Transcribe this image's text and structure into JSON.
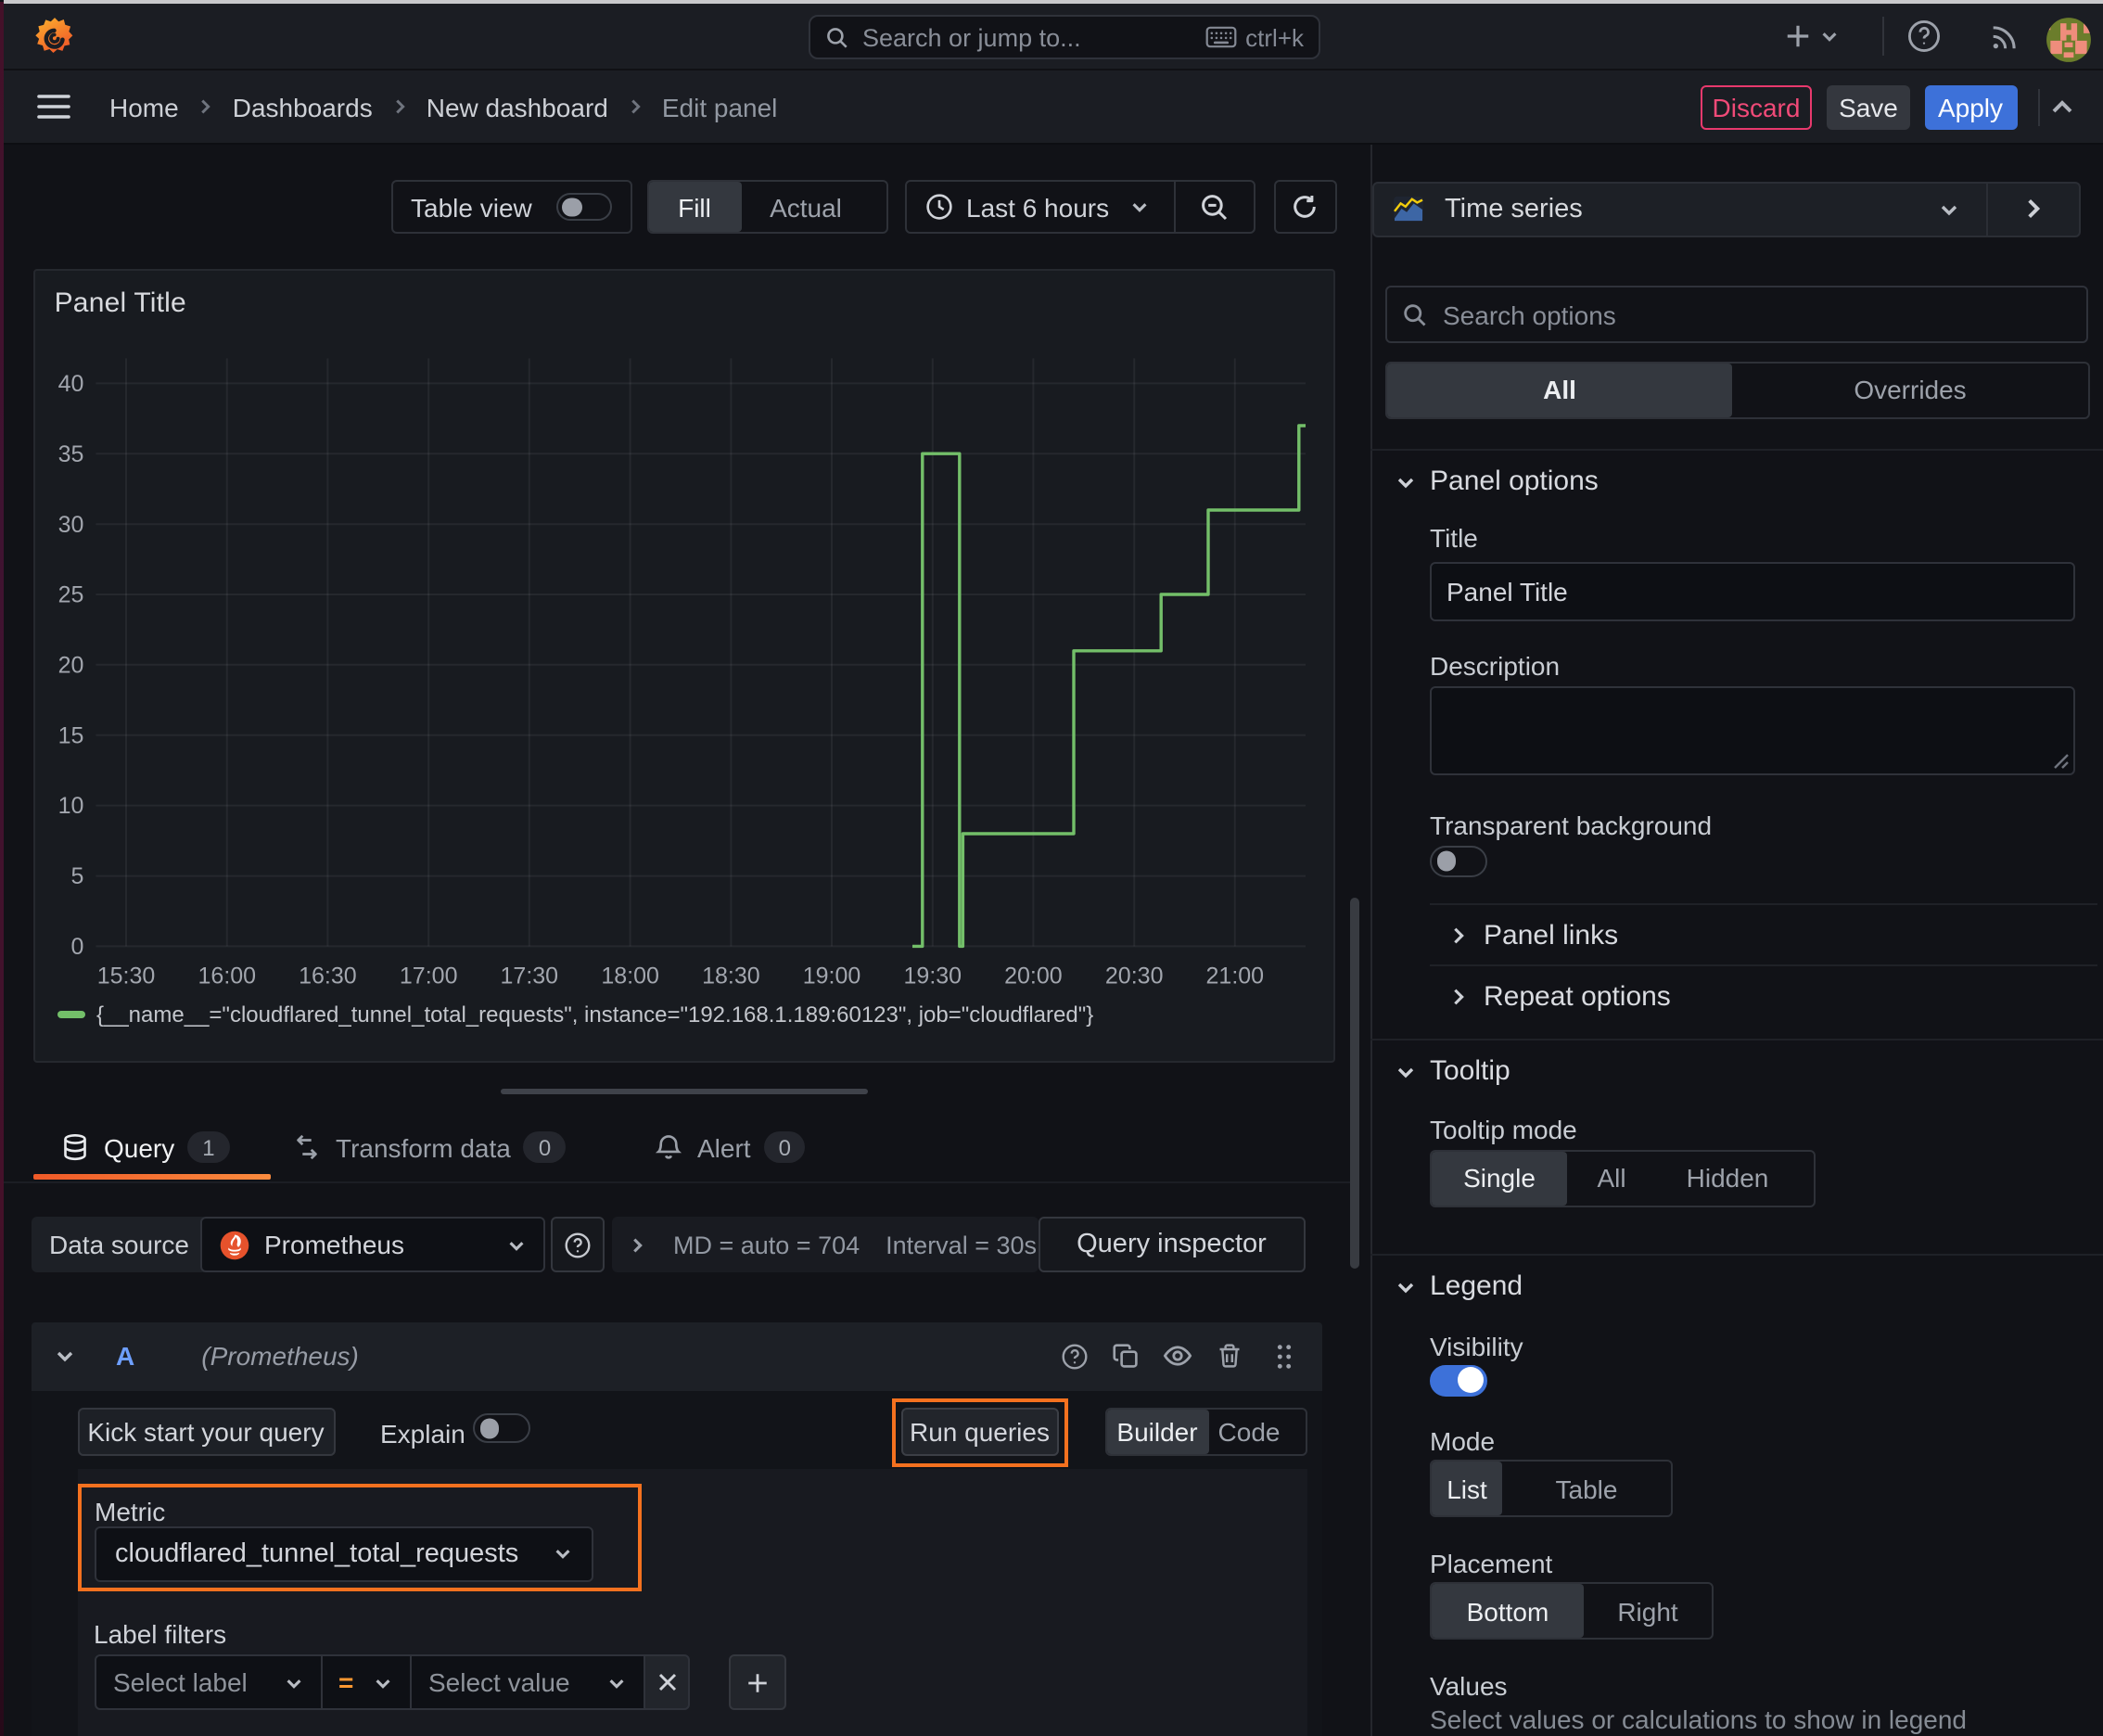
{
  "colors": {
    "accent_orange": "#f4711f",
    "tab_orange": "#f05a28",
    "series_green": "#73bf69",
    "primary_blue": "#3d71d9",
    "discard_pink": "#f14a78"
  },
  "icons": {
    "grafana-logo": "orange spiral flame logo",
    "search-icon": "magnifier",
    "keyboard-icon": "keyboard",
    "plus-icon": "+",
    "chevron-down-icon": "v",
    "chevron-right-icon": ">",
    "chevron-up-icon": "^",
    "help-icon": "? in circle",
    "rss-icon": "rss arcs",
    "avatar": "pixel-art avatar",
    "hamburger-icon": "three bars",
    "clock-icon": "clock",
    "zoom-out-icon": "magnifier with minus",
    "refresh-icon": "circular arrow",
    "timeseries-icon": "mini area chart",
    "database-icon": "db cylinder",
    "transform-icon": "cycle arrows",
    "bell-icon": "bell",
    "copy-icon": "two squares",
    "eye-icon": "eye",
    "trash-icon": "trash can",
    "grip-icon": "six dots",
    "close-icon": "x",
    "prometheus-icon": "orange flame circle",
    "resize-corner-icon": "diagonal grips"
  },
  "topbar": {
    "search_placeholder": "Search or jump to...",
    "search_shortcut": "ctrl+k"
  },
  "breadcrumb": {
    "items": [
      {
        "label": "Home"
      },
      {
        "label": "Dashboards"
      },
      {
        "label": "New dashboard"
      },
      {
        "label": "Edit panel"
      }
    ]
  },
  "actions": {
    "discard": "Discard",
    "save": "Save",
    "apply": "Apply"
  },
  "toolbar": {
    "table_view_label": "Table view",
    "table_view_on": false,
    "fill_actual": {
      "options": [
        "Fill",
        "Actual"
      ],
      "selected": "Fill"
    },
    "time_range": "Last 6 hours"
  },
  "visualization_picker": {
    "label": "Time series"
  },
  "panel": {
    "title": "Panel Title",
    "legend": "{__name__=\"cloudflared_tunnel_total_requests\", instance=\"192.168.1.189:60123\", job=\"cloudflared\"}"
  },
  "chart_data": {
    "type": "line",
    "line_style": "step-after",
    "series": [
      {
        "name": "{__name__=\"cloudflared_tunnel_total_requests\", instance=\"192.168.1.189:60123\", job=\"cloudflared\"}",
        "color": "#73bf69",
        "points": [
          [
            "19:24",
            0
          ],
          [
            "19:27",
            35
          ],
          [
            "19:38",
            0
          ],
          [
            "19:39",
            8
          ],
          [
            "20:12",
            21
          ],
          [
            "20:38",
            25
          ],
          [
            "20:52",
            31
          ],
          [
            "21:19",
            37
          ]
        ],
        "end_time": "21:21"
      }
    ],
    "title": "Panel Title",
    "xlabel": "",
    "ylabel": "",
    "x_range": [
      "15:21",
      "21:21"
    ],
    "x_ticks": [
      "15:30",
      "16:00",
      "16:30",
      "17:00",
      "17:30",
      "18:00",
      "18:30",
      "19:00",
      "19:30",
      "20:00",
      "20:30",
      "21:00"
    ],
    "ylim": [
      0,
      40
    ],
    "y_ticks": [
      0,
      5,
      10,
      15,
      20,
      25,
      30,
      35,
      40
    ],
    "grid": true,
    "legend_position": "bottom"
  },
  "query_tabs": {
    "tabs": [
      {
        "label": "Query",
        "count": "1",
        "active": true
      },
      {
        "label": "Transform data",
        "count": "0",
        "active": false
      },
      {
        "label": "Alert",
        "count": "0",
        "active": false
      }
    ]
  },
  "datasource_row": {
    "label": "Data source",
    "datasource": "Prometheus",
    "stats_md": "MD = auto = 704",
    "stats_interval": "Interval = 30s",
    "query_inspector": "Query inspector"
  },
  "query_row": {
    "ref_id": "A",
    "datasource_hint": "(Prometheus)",
    "kick_start": "Kick start your query",
    "explain_label": "Explain",
    "explain_on": false,
    "run_queries": "Run queries",
    "editor_mode": {
      "options": [
        "Builder",
        "Code"
      ],
      "selected": "Builder"
    },
    "metric_label": "Metric",
    "metric_value": "cloudflared_tunnel_total_requests",
    "label_filters_label": "Label filters",
    "select_label_placeholder": "Select label",
    "operator": "=",
    "select_value_placeholder": "Select value"
  },
  "options_pane": {
    "search_placeholder": "Search options",
    "filter_tabs": {
      "options": [
        "All",
        "Overrides"
      ],
      "selected": "All"
    },
    "panel_options": {
      "header": "Panel options",
      "title_label": "Title",
      "title_value": "Panel Title",
      "description_label": "Description",
      "description_value": "",
      "transparent_label": "Transparent background",
      "transparent_on": false
    },
    "collapsed_sections": [
      "Panel links",
      "Repeat options"
    ],
    "panel_links_label": "Panel links",
    "repeat_options_label": "Repeat options",
    "tooltip": {
      "header": "Tooltip",
      "mode_label": "Tooltip mode",
      "mode": {
        "options": [
          "Single",
          "All",
          "Hidden"
        ],
        "selected": "Single"
      }
    },
    "legend": {
      "header": "Legend",
      "visibility_label": "Visibility",
      "visibility_on": true,
      "mode_label": "Mode",
      "mode": {
        "options": [
          "List",
          "Table"
        ],
        "selected": "List"
      },
      "placement_label": "Placement",
      "placement": {
        "options": [
          "Bottom",
          "Right"
        ],
        "selected": "Bottom"
      },
      "values_label": "Values",
      "values_desc": "Select values or calculations to show in legend"
    }
  }
}
